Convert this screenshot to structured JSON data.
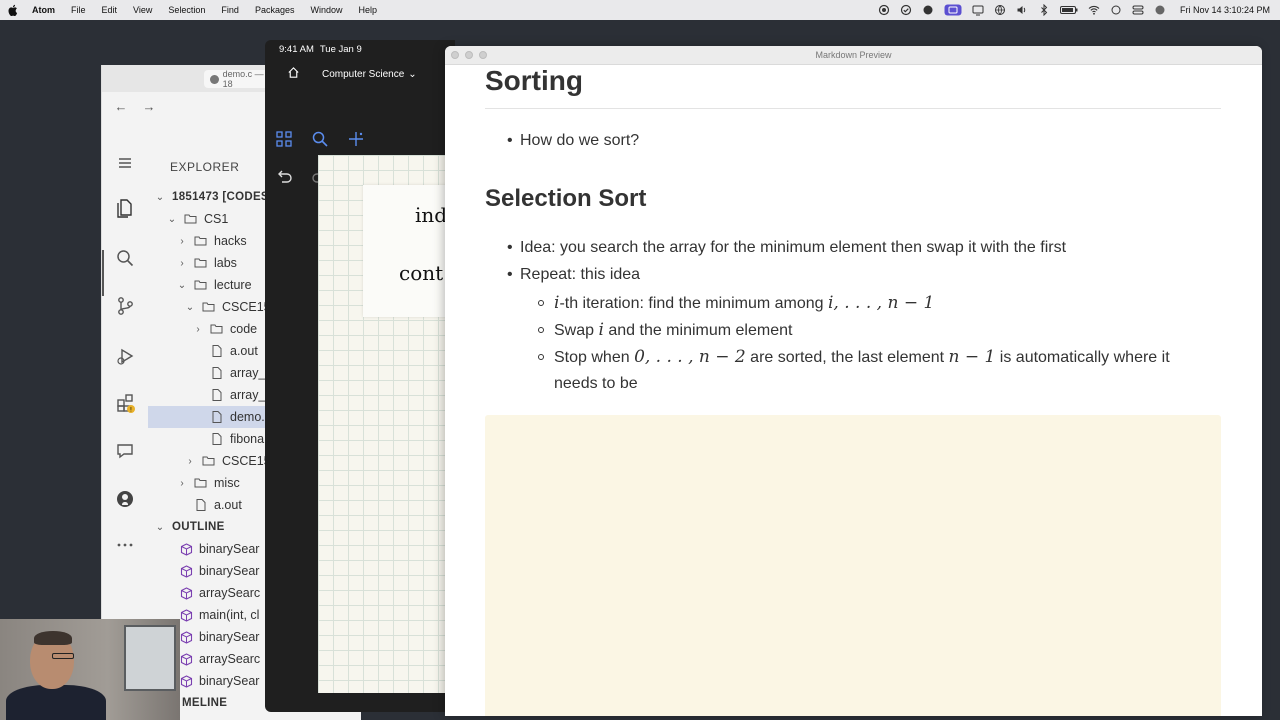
{
  "menubar": {
    "app": "Atom",
    "items": [
      "File",
      "Edit",
      "View",
      "Selection",
      "Find",
      "Packages",
      "Window",
      "Help"
    ],
    "clock": "Fri Nov 14  3:10:24 PM"
  },
  "vscode": {
    "tab_label": "demo.c — 18",
    "explorer_title": "EXPLORER",
    "tree": [
      {
        "label": "1851473 [CODES",
        "type": "root"
      },
      {
        "label": "CS1",
        "type": "folder-open"
      },
      {
        "label": "hacks",
        "type": "folder"
      },
      {
        "label": "labs",
        "type": "folder"
      },
      {
        "label": "lecture",
        "type": "folder-open"
      },
      {
        "label": "CSCE15",
        "type": "folder-open"
      },
      {
        "label": "code",
        "type": "folder"
      },
      {
        "label": "a.out",
        "type": "file"
      },
      {
        "label": "array_",
        "type": "file"
      },
      {
        "label": "array_",
        "type": "file"
      },
      {
        "label": "demo.",
        "type": "file"
      },
      {
        "label": "fibona",
        "type": "file"
      },
      {
        "label": "CSCE15",
        "type": "folder"
      },
      {
        "label": "misc",
        "type": "folder"
      },
      {
        "label": "a.out",
        "type": "file"
      }
    ],
    "outline_title": "OUTLINE",
    "outline": [
      "binarySear",
      "binarySear",
      "arraySearc",
      "main(int, cl",
      "binarySear",
      "arraySearc",
      "binarySear"
    ],
    "timeline_title": "MELINE"
  },
  "ipad": {
    "time": "9:41 AM",
    "date": "Tue Jan 9",
    "notebook": "Computer Science",
    "handwriting": [
      "ind",
      "cont"
    ]
  },
  "atom": {
    "window_title": "Markdown Preview",
    "h1": "Sorting",
    "sorting_items": [
      "How do we sort?"
    ],
    "h2": "Selection Sort",
    "items": {
      "idea": "Idea: you search the array for the minimum element then swap it with the first",
      "repeat": "Repeat: this idea",
      "sub1_i": "i",
      "sub1_text": "-th iteration: find the minimum among ",
      "sub1_math": "i, . . . , n − 1",
      "sub2_pre": "Swap ",
      "sub2_math": "i",
      "sub2_post": " and the minimum element",
      "sub3_pre": "Stop when ",
      "sub3_math1": "0, . . . , n − 2",
      "sub3_mid": " are sorted, the last element ",
      "sub3_math2": "n − 1",
      "sub3_post": " is automatically where it",
      "sub3_line2": "needs to be"
    }
  },
  "colors": {
    "code_block_bg": "#fbf6e4",
    "selected_row": "#cfd7ea",
    "ipad_accent": "#2a3e6c"
  }
}
